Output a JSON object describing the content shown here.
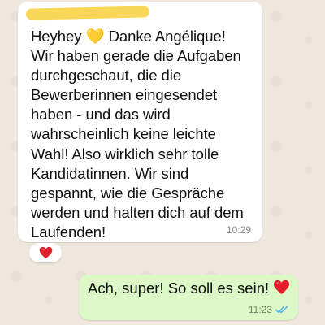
{
  "chat": {
    "incoming": {
      "text": "Heyhey 💛 Danke Angélique!\nWir haben gerade die Aufgaben\ndurchgeschaut, die die\nBewerberinnen eingesendet\nhaben - und das wird\nwahrscheinlich keine leichte\nWahl! Also wirklich sehr tolle\nKandidatinnen. Wir sind\ngespannt, wie die Gespräche\nwerden und halten dich auf dem\nLaufenden!",
      "time": "10:29",
      "reaction_icon": "red-heart-icon"
    },
    "outgoing": {
      "text": "Ach, super! So soll es sein!",
      "emoji_icon": "red-heart-icon",
      "time": "11:23",
      "status_icon": "double-check-read-icon"
    }
  },
  "colors": {
    "background": "#efe7de",
    "incoming_bubble": "#ffffff",
    "outgoing_bubble": "#dcf8c6",
    "read_ticks": "#4fb6ec",
    "sender_highlight": "#f7d34a"
  }
}
